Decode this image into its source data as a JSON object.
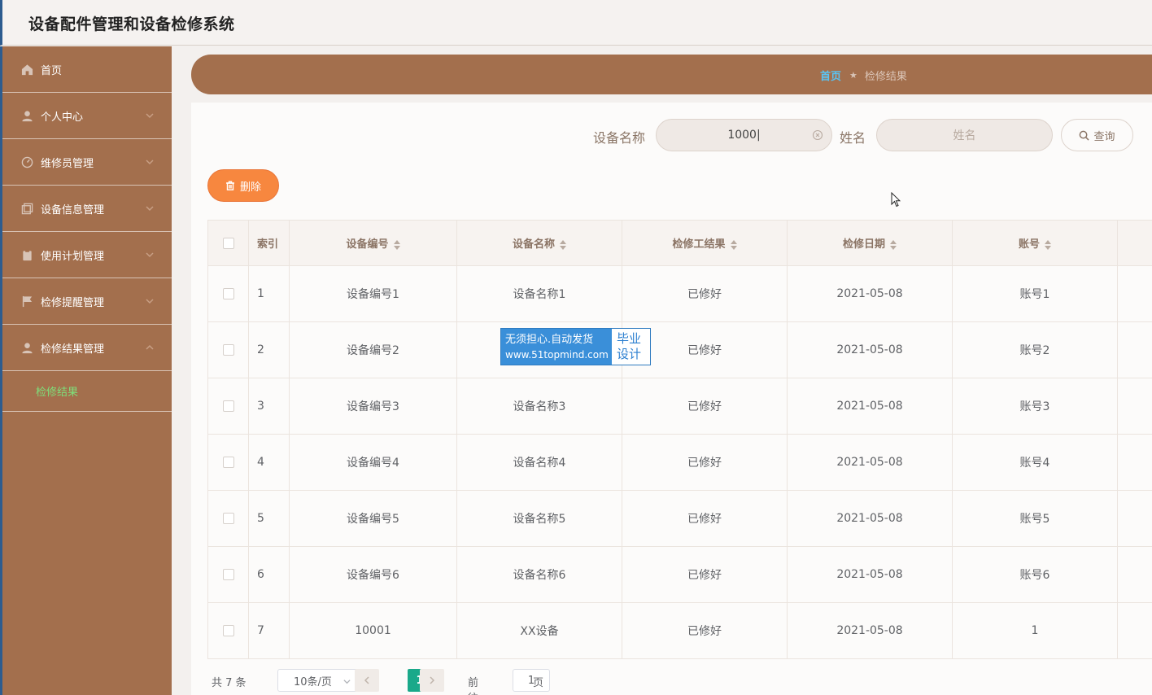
{
  "app": {
    "title": "设备配件管理和设备检修系统"
  },
  "sidebar": {
    "items": [
      {
        "label": "首页",
        "icon": "home-icon"
      },
      {
        "label": "个人中心",
        "icon": "user-icon"
      },
      {
        "label": "维修员管理",
        "icon": "gauge-icon"
      },
      {
        "label": "设备信息管理",
        "icon": "copy-icon"
      },
      {
        "label": "使用计划管理",
        "icon": "clipboard-icon"
      },
      {
        "label": "检修提醒管理",
        "icon": "flag-icon"
      },
      {
        "label": "检修结果管理",
        "icon": "user-icon",
        "expanded": true
      }
    ],
    "submenu": {
      "label": "检修结果",
      "color": "#7ee07a"
    }
  },
  "breadcrumb": {
    "home": "首页",
    "separator": "★",
    "current": "检修结果"
  },
  "search": {
    "device_name_label": "设备名称",
    "device_name_value": "1000|",
    "name_label": "姓名",
    "name_placeholder": "姓名",
    "query_label": "查询"
  },
  "actions": {
    "delete_label": "删除"
  },
  "table": {
    "headers": [
      "索引",
      "设备编号",
      "设备名称",
      "检修工结果",
      "检修日期",
      "账号"
    ],
    "rows": [
      [
        "1",
        "设备编号1",
        "设备名称1",
        "已修好",
        "2021-05-08",
        "账号1"
      ],
      [
        "2",
        "设备编号2",
        "",
        "已修好",
        "2021-05-08",
        "账号2"
      ],
      [
        "3",
        "设备编号3",
        "设备名称3",
        "已修好",
        "2021-05-08",
        "账号3"
      ],
      [
        "4",
        "设备编号4",
        "设备名称4",
        "已修好",
        "2021-05-08",
        "账号4"
      ],
      [
        "5",
        "设备编号5",
        "设备名称5",
        "已修好",
        "2021-05-08",
        "账号5"
      ],
      [
        "6",
        "设备编号6",
        "设备名称6",
        "已修好",
        "2021-05-08",
        "账号6"
      ],
      [
        "7",
        "10001",
        "XX设备",
        "已修好",
        "2021-05-08",
        "1"
      ]
    ]
  },
  "pagination": {
    "total": "共 7 条",
    "page_size": "10条/页",
    "current_page": "1",
    "goto_prefix": "前往",
    "goto_value": "1",
    "goto_suffix": "页"
  },
  "watermark": {
    "line1": "无须担心.自动发货",
    "line2": "www.51topmind.com",
    "right1": "毕业",
    "right2": "设计"
  },
  "colors": {
    "sidebar": "#a36f4d",
    "accent_delete": "#f7873f",
    "page_active": "#1aa98a",
    "breadcrumb_home": "#59c4f5"
  }
}
